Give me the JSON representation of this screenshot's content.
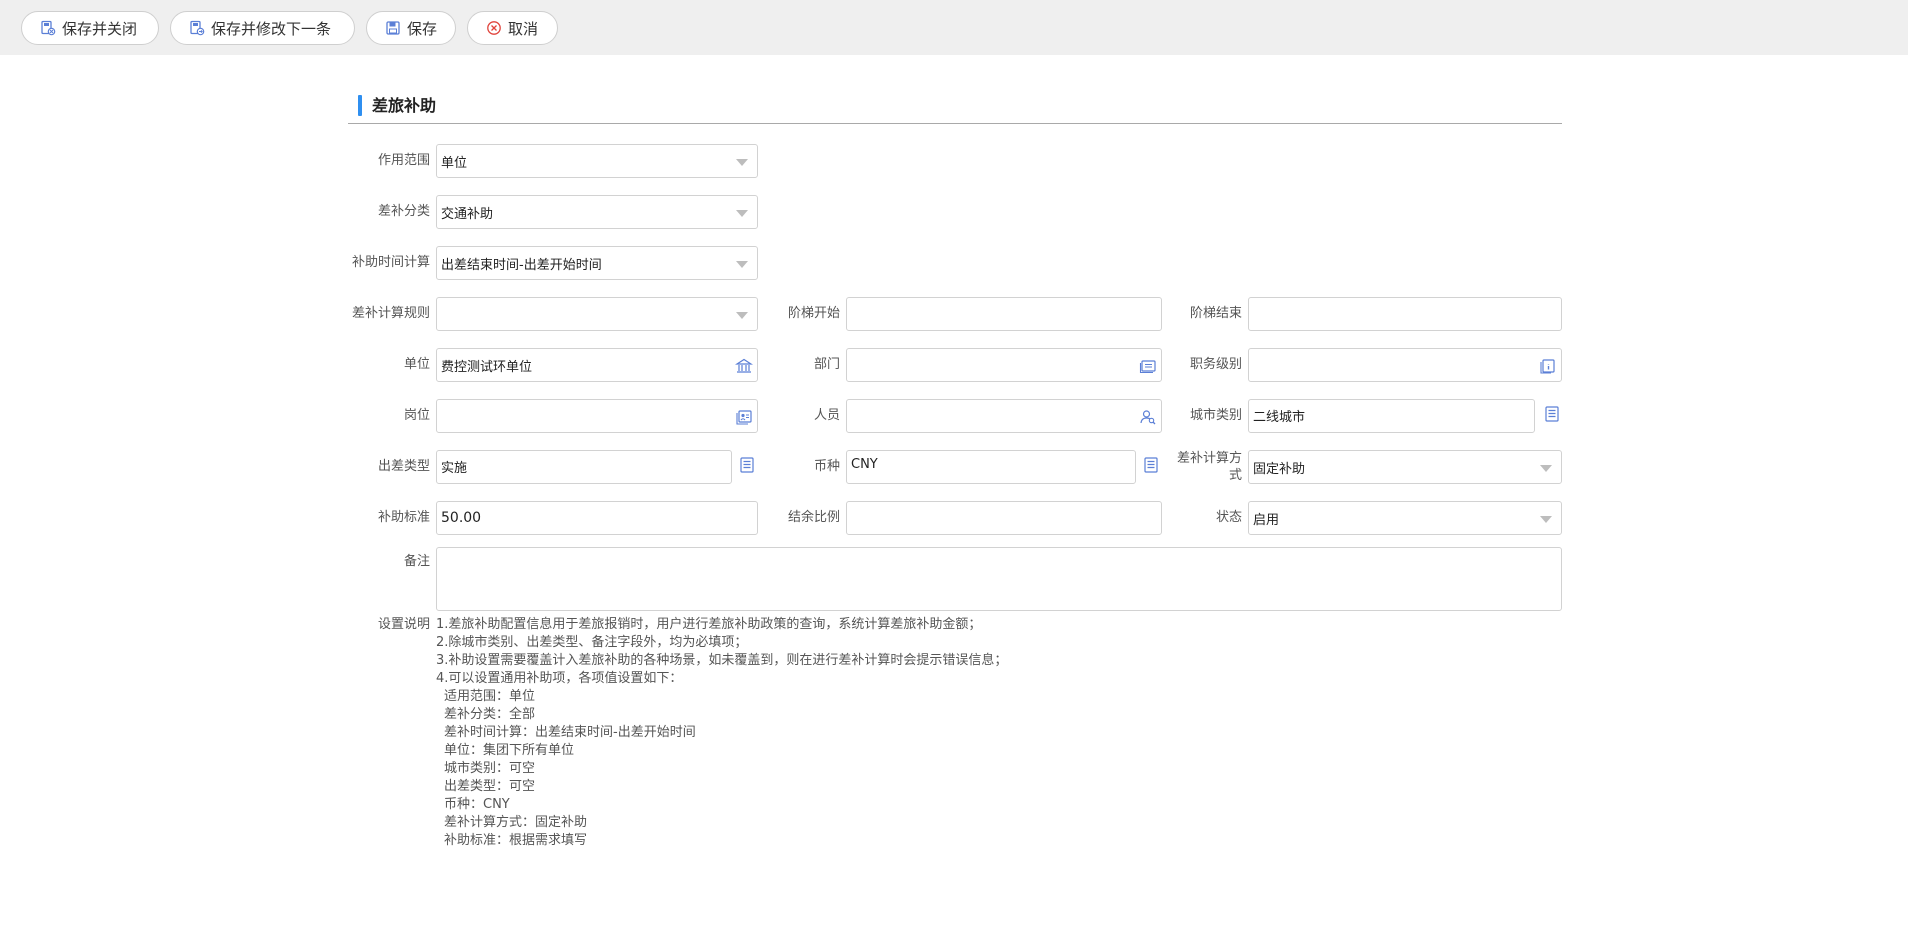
{
  "toolbar": {
    "save_close": "保存并关闭",
    "save_next": "保存并修改下一条",
    "save": "保存",
    "cancel": "取消"
  },
  "section": {
    "title": "差旅补助"
  },
  "form": {
    "scope": {
      "label": "作用范围",
      "value": "单位"
    },
    "category": {
      "label": "差补分类",
      "value": "交通补助"
    },
    "time_calc": {
      "label": "补助时间计算",
      "value": "出差结束时间-出差开始时间"
    },
    "calc_rule": {
      "label": "差补计算规则",
      "value": ""
    },
    "step_start": {
      "label": "阶梯开始",
      "value": ""
    },
    "step_end": {
      "label": "阶梯结束",
      "value": ""
    },
    "unit": {
      "label": "单位",
      "value": "费控测试环单位"
    },
    "dept": {
      "label": "部门",
      "value": ""
    },
    "job_level": {
      "label": "职务级别",
      "value": ""
    },
    "post": {
      "label": "岗位",
      "value": ""
    },
    "person": {
      "label": "人员",
      "value": ""
    },
    "city_type": {
      "label": "城市类别",
      "value": "二线城市"
    },
    "trip_type": {
      "label": "出差类型",
      "value": "实施"
    },
    "currency": {
      "label": "币种",
      "value": "CNY"
    },
    "calc_method": {
      "label": "差补计算方式",
      "value": "固定补助"
    },
    "standard": {
      "label": "补助标准",
      "value": "50.00"
    },
    "surplus_ratio": {
      "label": "结余比例",
      "value": ""
    },
    "status": {
      "label": "状态",
      "value": "启用"
    },
    "remark": {
      "label": "备注",
      "value": ""
    },
    "instructions": {
      "label": "设置说明",
      "lines": [
        "1.差旅补助配置信息用于差旅报销时，用户进行差旅补助政策的查询，系统计算差旅补助金额；",
        "2.除城市类别、出差类型、备注字段外，均为必填项；",
        "3.补助设置需要覆盖计入差旅补助的各种场景，如未覆盖到，则在进行差补计算时会提示错误信息；",
        "4.可以设置通用补助项，各项值设置如下："
      ],
      "sub_lines": [
        "适用范围：单位",
        "差补分类：全部",
        "差补时间计算：出差结束时间-出差开始时间",
        "单位：集团下所有单位",
        "城市类别：可空",
        "出差类型：可空",
        "币种：CNY",
        "差补计算方式：固定补助",
        "补助标准：根据需求填写"
      ]
    }
  },
  "icons": {
    "save_close": "save-close-icon",
    "save_next": "save-next-icon",
    "save": "floppy-disk-icon",
    "cancel": "cancel-circle-icon",
    "unit": "building-icon",
    "dept": "org-card-icon",
    "job_level": "id-card-icon",
    "post": "post-card-icon",
    "person": "person-search-icon",
    "lookup": "list-lookup-icon"
  },
  "colors": {
    "accent": "#2f8ff0",
    "icon": "#5b7fd6",
    "cancel": "#e0443c"
  }
}
